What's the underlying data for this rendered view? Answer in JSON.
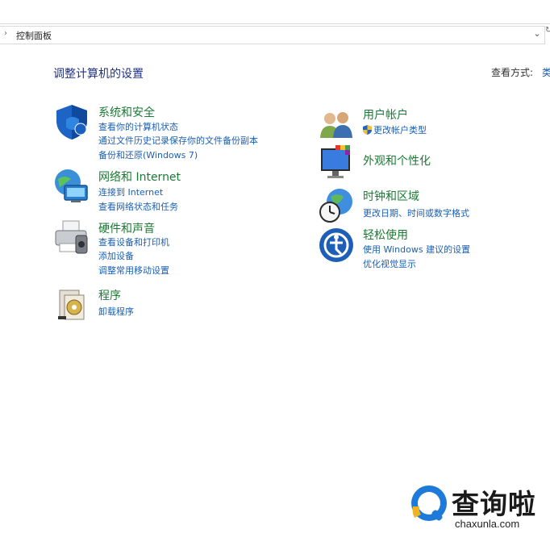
{
  "address_bar": {
    "path": "控制面板"
  },
  "page": {
    "title": "调整计算机的设置",
    "view_by_label": "查看方式:",
    "view_by_value": "类别"
  },
  "categories": [
    {
      "title": "系统和安全",
      "icon": "shield-icon",
      "links": [
        "查看你的计算机状态",
        "通过文件历史记录保存你的文件备份副本",
        "备份和还原(Windows 7)"
      ]
    },
    {
      "title": "网络和 Internet",
      "icon": "network-icon",
      "links": [
        "连接到 Internet",
        "查看网络状态和任务"
      ]
    },
    {
      "title": "硬件和声音",
      "icon": "printer-icon",
      "links": [
        "查看设备和打印机",
        "添加设备",
        "调整常用移动设置"
      ]
    },
    {
      "title": "程序",
      "icon": "programs-icon",
      "links": [
        "卸载程序"
      ]
    },
    {
      "title": "用户帐户",
      "icon": "users-icon",
      "links": [
        "更改帐户类型"
      ]
    },
    {
      "title": "外观和个性化",
      "icon": "display-icon",
      "links": []
    },
    {
      "title": "时钟和区域",
      "icon": "clock-globe-icon",
      "links": [
        "更改日期、时间或数字格式"
      ]
    },
    {
      "title": "轻松使用",
      "icon": "ease-of-access-icon",
      "links": [
        "使用 Windows 建议的设置",
        "优化视觉显示"
      ]
    }
  ],
  "watermark": {
    "text": "查询啦",
    "sub": "chaxunla.com"
  },
  "colors": {
    "category_title": "#1a7a34",
    "link": "#1a5fb4",
    "page_title": "#1e3287"
  }
}
